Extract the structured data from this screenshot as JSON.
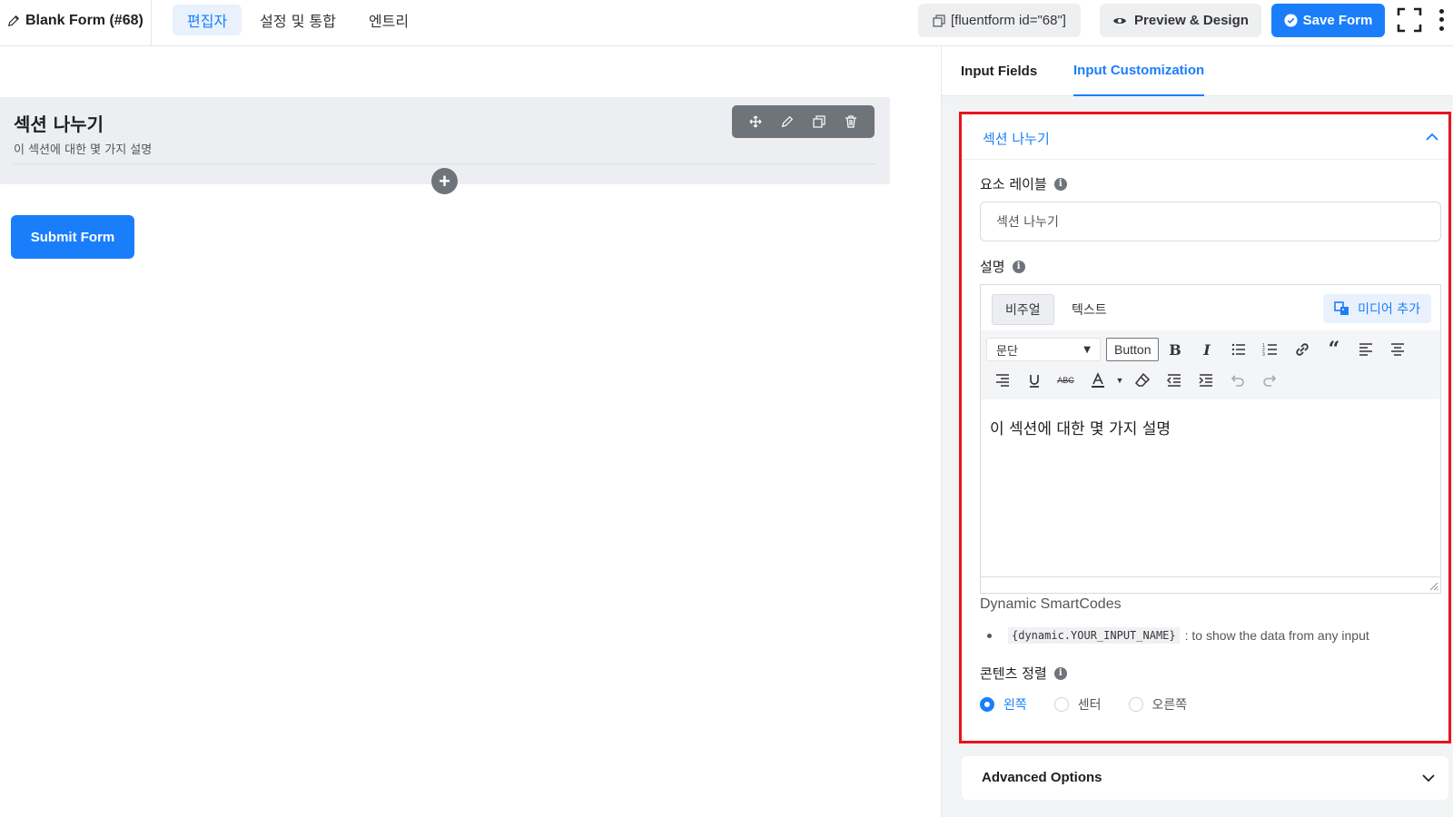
{
  "header": {
    "form_title": "Blank Form (#68)",
    "nav": [
      "편집자",
      "설정 및 통합",
      "엔트리"
    ],
    "shortcode": "[fluentform id=\"68\"]",
    "preview_label": "Preview & Design",
    "save_label": "Save Form"
  },
  "editor": {
    "section_title": "섹션 나누기",
    "section_description": "이 섹션에 대한 몇 가지 설명",
    "submit_label": "Submit Form"
  },
  "sidebar": {
    "tabs": [
      "Input Fields",
      "Input Customization"
    ],
    "active_tab": "Input Customization",
    "panel_title": "섹션 나누기",
    "element_label": {
      "label": "요소 레이블",
      "value": "섹션 나누기"
    },
    "description": {
      "label": "설명",
      "visual_tab": "비주얼",
      "text_tab": "텍스트",
      "media_button": "미디어 추가",
      "format_select": "문단",
      "button_label": "Button",
      "content": "이 섹션에 대한 몇 가지 설명"
    },
    "smartcodes": {
      "title": "Dynamic SmartCodes",
      "code": "{dynamic.YOUR_INPUT_NAME}",
      "desc": ": to show the data from any input"
    },
    "alignment": {
      "label": "콘텐츠 정렬",
      "options": [
        "왼쪽",
        "센터",
        "오른쪽"
      ],
      "selected": "왼쪽"
    },
    "advanced_title": "Advanced Options"
  },
  "colors": {
    "accent": "#1a7efb",
    "highlight_border": "#e5141d"
  }
}
